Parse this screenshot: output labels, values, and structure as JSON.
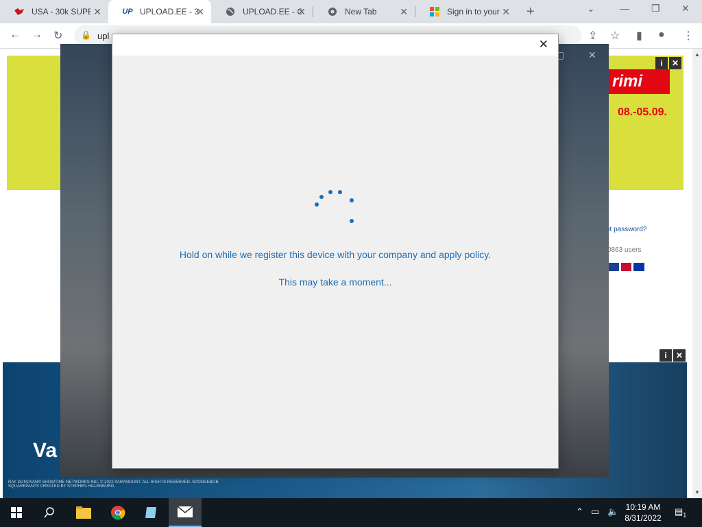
{
  "browser": {
    "tabs": [
      {
        "title": "USA - 30k SUPE",
        "favicon": "red-bird-icon"
      },
      {
        "title": "UPLOAD.EE - 30",
        "favicon": "upload-ee-icon",
        "favicon_text": "UP"
      },
      {
        "title": "UPLOAD.EE - C",
        "favicon": "globe-icon"
      },
      {
        "title": "New Tab",
        "favicon": "chrome-icon"
      },
      {
        "title": "Sign in to your",
        "favicon": "microsoft-icon"
      }
    ],
    "address_bar": {
      "url": "upl"
    }
  },
  "webpage": {
    "top_ad": {
      "brand": "rimi",
      "date": "08.-05.09."
    },
    "forgot_password": "ot password?",
    "users_count": "0863 users",
    "bottom_ad": {
      "headline": "Va",
      "fine_print": "RAY DONOVAN® SHOWTIME NETWORKS INC. © 2022 PARAMOUNT. ALL RIGHTS RESERVED. SPONGEBOB SQUAREPANTS CREATED BY STEPHEN HILLENBURG."
    },
    "ad_info": "i",
    "ad_close": "✕"
  },
  "dialog": {
    "message": "Hold on while we register this device with your company and apply policy.",
    "submessage": "This may take a moment...",
    "close_label": "✕"
  },
  "taskbar": {
    "time": "10:19 AM",
    "date": "8/31/2022",
    "notification_count": "1"
  },
  "colors": {
    "accent": "#1f6cb5",
    "taskbar": "#101820",
    "dialog_bg": "#f0f0f0"
  }
}
